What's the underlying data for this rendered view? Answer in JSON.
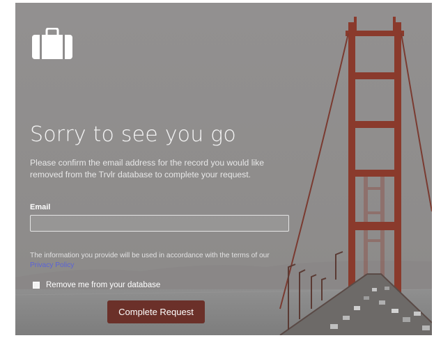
{
  "logo": {
    "icon": "suitcase-icon"
  },
  "heading": "Sorry to see you go",
  "description": "Please confirm the email address for the record you would like removed from the Trvlr database to complete your request.",
  "email": {
    "label": "Email",
    "value": "",
    "placeholder": ""
  },
  "info": {
    "text": "The information you provide will be used in accordance with the terms of our ",
    "link_text": "Privacy Policy"
  },
  "remove_checkbox": {
    "label": "Remove me from your database",
    "checked": false
  },
  "submit_label": "Complete Request",
  "colors": {
    "button": "#6b3029",
    "link": "#5b63d8",
    "overlay": "#8f8d8d",
    "bridge": "#8a3a2c"
  }
}
